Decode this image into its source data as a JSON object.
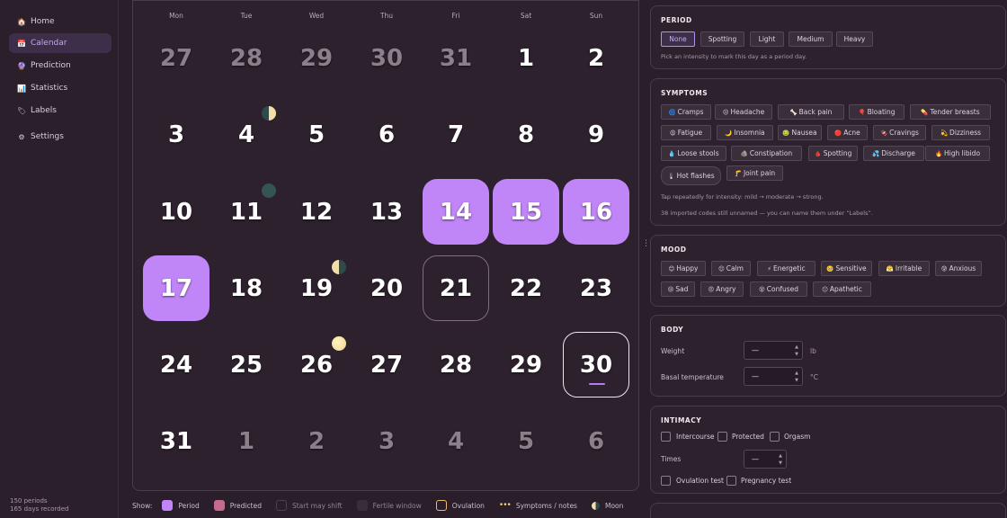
{
  "sidebar": {
    "items": [
      {
        "icon": "🏠",
        "label": "Home"
      },
      {
        "icon": "📅",
        "label": "Calendar"
      },
      {
        "icon": "🔮",
        "label": "Prediction"
      },
      {
        "icon": "📊",
        "label": "Statistics"
      },
      {
        "icon": "🏷",
        "label": "Labels"
      },
      {
        "icon": "⚙",
        "label": "Settings"
      }
    ],
    "active": "Calendar",
    "footer": {
      "periods": "150 periods",
      "days": "165 days recorded"
    }
  },
  "calendar": {
    "weekdays": [
      "Mon",
      "Tue",
      "Wed",
      "Thu",
      "Fri",
      "Sat",
      "Sun"
    ],
    "weeks": [
      [
        "27",
        "28",
        "29",
        "30",
        "31",
        "1",
        "2"
      ],
      [
        "3",
        "4",
        "5",
        "6",
        "7",
        "8",
        "9"
      ],
      [
        "10",
        "11",
        "12",
        "13",
        "14",
        "15",
        "16"
      ],
      [
        "17",
        "18",
        "19",
        "20",
        "21",
        "22",
        "23"
      ],
      [
        "24",
        "25",
        "26",
        "27",
        "28",
        "29",
        "30"
      ],
      [
        "31",
        "1",
        "2",
        "3",
        "4",
        "5",
        "6"
      ]
    ],
    "other_month_cells": [
      "0-0",
      "0-1",
      "0-2",
      "0-3",
      "0-4",
      "5-1",
      "5-2",
      "5-3",
      "5-4",
      "5-5",
      "5-6"
    ],
    "period_days": [
      "14",
      "15",
      "16",
      "17"
    ],
    "selected_day": "21",
    "today": "30",
    "moon_phases": [
      {
        "day": "4",
        "phase": "first-quarter"
      },
      {
        "day": "11",
        "phase": "new-moon"
      },
      {
        "day": "19",
        "phase": "last-quarter"
      },
      {
        "day": "26",
        "phase": "full-moon"
      }
    ],
    "colors": {
      "period": "#c085f7",
      "predicted": "#c56a8e",
      "ovulation": "#f0b86e"
    }
  },
  "legend": {
    "show_label": "Show:",
    "items": [
      "Period",
      "Predicted",
      "Start may shift",
      "Fertile window",
      "Ovulation",
      "Symptoms / notes",
      "Moon"
    ]
  },
  "period": {
    "title": "PERIOD",
    "options": [
      "None",
      "Spotting",
      "Light",
      "Medium",
      "Heavy"
    ],
    "selected": "None",
    "hint": "Pick an intensity to mark this day as a period day."
  },
  "symptoms": {
    "title": "SYMPTOMS",
    "items": [
      {
        "icon": "🌀",
        "label": "Cramps"
      },
      {
        "icon": "😣",
        "label": "Headache"
      },
      {
        "icon": "🦴",
        "label": "Back pain"
      },
      {
        "icon": "🎈",
        "label": "Bloating"
      },
      {
        "icon": "💊",
        "label": "Tender breasts"
      },
      {
        "icon": "😩",
        "label": "Fatigue"
      },
      {
        "icon": "🌙",
        "label": "Insomnia"
      },
      {
        "icon": "🤢",
        "label": "Nausea"
      },
      {
        "icon": "🔴",
        "label": "Acne"
      },
      {
        "icon": "🍫",
        "label": "Cravings"
      },
      {
        "icon": "💫",
        "label": "Dizziness"
      },
      {
        "icon": "💧",
        "label": "Loose stools"
      },
      {
        "icon": "🪨",
        "label": "Constipation"
      },
      {
        "icon": "🩸",
        "label": "Spotting"
      },
      {
        "icon": "💦",
        "label": "Discharge"
      },
      {
        "icon": "🔥",
        "label": "High libido"
      },
      {
        "icon": "🌡",
        "label": "Hot flashes"
      },
      {
        "icon": "🦵",
        "label": "Joint pain"
      }
    ],
    "hint1": "Tap repeatedly for intensity: mild → moderate → strong.",
    "hint2": "38 imported codes still unnamed — you can name them under “Labels”."
  },
  "mood": {
    "title": "MOOD",
    "items": [
      {
        "icon": "😊",
        "label": "Happy"
      },
      {
        "icon": "😌",
        "label": "Calm"
      },
      {
        "icon": "⚡",
        "label": "Energetic"
      },
      {
        "icon": "🥺",
        "label": "Sensitive"
      },
      {
        "icon": "😤",
        "label": "Irritable"
      },
      {
        "icon": "😰",
        "label": "Anxious"
      },
      {
        "icon": "😢",
        "label": "Sad"
      },
      {
        "icon": "😠",
        "label": "Angry"
      },
      {
        "icon": "😵",
        "label": "Confused"
      },
      {
        "icon": "😑",
        "label": "Apathetic"
      }
    ]
  },
  "body": {
    "title": "BODY",
    "weight_label": "Weight",
    "weight_value": "—",
    "weight_unit": "lb",
    "temp_label": "Basal temperature",
    "temp_value": "—",
    "temp_unit": "°C"
  },
  "intimacy": {
    "title": "INTIMACY",
    "checks": [
      "Intercourse",
      "Protected",
      "Orgasm"
    ],
    "times_label": "Times",
    "times_value": "—",
    "tests": [
      "Ovulation test",
      "Pregnancy test"
    ]
  }
}
